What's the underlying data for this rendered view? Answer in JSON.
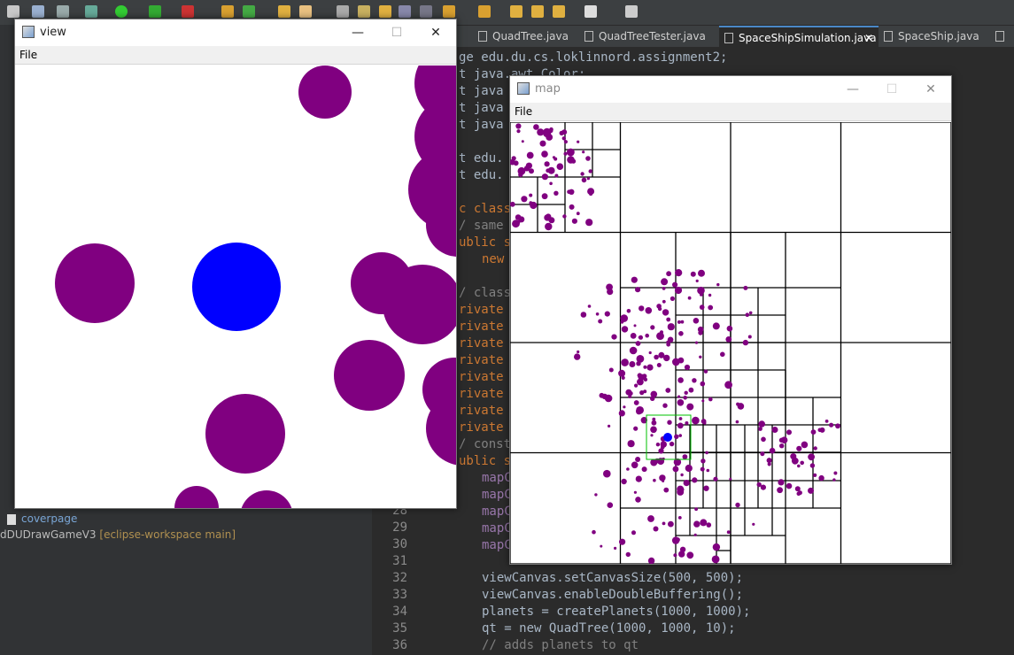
{
  "editor_tabs": [
    {
      "label": "QuadTree.java",
      "active": false
    },
    {
      "label": "QuadTreeTester.java",
      "active": false
    },
    {
      "label": "SpaceShipSimulation.java",
      "active": true
    },
    {
      "label": "SpaceShip.java",
      "active": false
    }
  ],
  "project_panel": {
    "items": [
      "coverpage",
      "dDUDrawGameV3",
      "[eclipse-workspace main]"
    ]
  },
  "code": {
    "line_numbers": [
      "28",
      "29",
      "30",
      "31",
      "32",
      "33",
      "34",
      "35",
      "36"
    ],
    "visible_fragments": {
      "package_line": "ge edu.du.cs.loklinnord.assignment2;",
      "import_color": "t java.awt.Color;",
      "import2": "t java",
      "import3": "t java",
      "import4": "t java",
      "import5": "t edu.",
      "import6": "t edu.",
      "class_line": "c class",
      "comment_same": "/ same",
      "public_line": "ublic s",
      "new_line": "new",
      "comment_class": "/ class",
      "private_word": "rivate",
      "comment_const": "/ const",
      "public2": "ublic s",
      "mapc": "mapC",
      "code32": "viewCanvas.setCanvasSize(500, 500);",
      "code33": "viewCanvas.enableDoubleBuffering();",
      "code34": "planets = createPlanets(1000, 1000);",
      "code35": "qt = new QuadTree(1000, 1000, 10);",
      "code36": "// adds planets to qt"
    }
  },
  "view_window": {
    "title": "view",
    "menu": "File",
    "colors": {
      "planet": "#800080",
      "ship": "#0000ff",
      "background": "#ffffff"
    }
  },
  "map_window": {
    "title": "map",
    "menu": "File",
    "colors": {
      "planet": "#800080",
      "ship": "#0000ff",
      "grid": "#000000",
      "view_box": "#00c000"
    }
  },
  "window_controls": {
    "minimize": "—",
    "maximize": "☐",
    "close": "✕"
  }
}
